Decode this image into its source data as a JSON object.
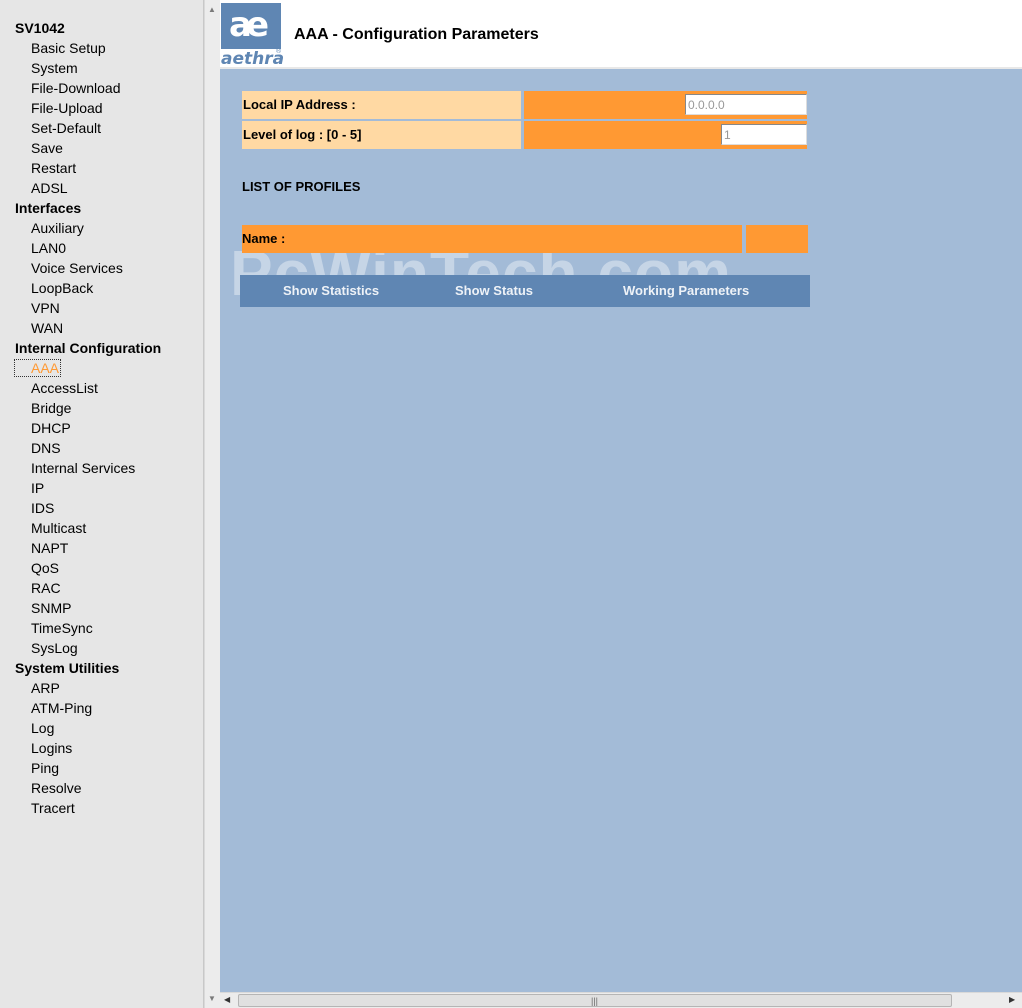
{
  "nav": {
    "device": "SV1042",
    "device_items": [
      "Basic Setup",
      "System",
      "File-Download",
      "File-Upload",
      "Set-Default",
      "Save",
      "Restart",
      "ADSL"
    ],
    "interfaces_label": "Interfaces",
    "interfaces_items": [
      "Auxiliary",
      "LAN0",
      "Voice Services",
      "LoopBack",
      "VPN",
      "WAN"
    ],
    "internal_label": "Internal Configuration",
    "internal_items": [
      "AAA",
      "AccessList",
      "Bridge",
      "DHCP",
      "DNS",
      "Internal Services",
      "IP",
      "IDS",
      "Multicast",
      "NAPT",
      "QoS",
      "RAC",
      "SNMP",
      "TimeSync",
      "SysLog"
    ],
    "utilities_label": "System Utilities",
    "utilities_items": [
      "ARP",
      "ATM-Ping",
      "Log",
      "Logins",
      "Ping",
      "Resolve",
      "Tracert"
    ],
    "active_item": "AAA"
  },
  "header": {
    "logo_mark": "ae",
    "logo_word": "aethra",
    "logo_reg": "®",
    "title": "AAA - Configuration Parameters"
  },
  "form": {
    "local_ip_label": "Local IP Address :",
    "local_ip_value": "0.0.0.0",
    "log_level_label": "Level of log : [0 - 5]",
    "log_level_value": "1"
  },
  "profiles": {
    "title": "LIST OF PROFILES",
    "name_header": "Name :"
  },
  "actions": {
    "show_statistics": "Show Statistics",
    "show_status": "Show Status",
    "working_parameters": "Working Parameters"
  },
  "watermark": "PcWinTech.com",
  "colors": {
    "content_bg": "#a3bbd7",
    "label_bg": "#ffd9a3",
    "value_bg": "#ff9933",
    "action_bar": "#5f86b3",
    "active_nav": "#ff9933"
  }
}
